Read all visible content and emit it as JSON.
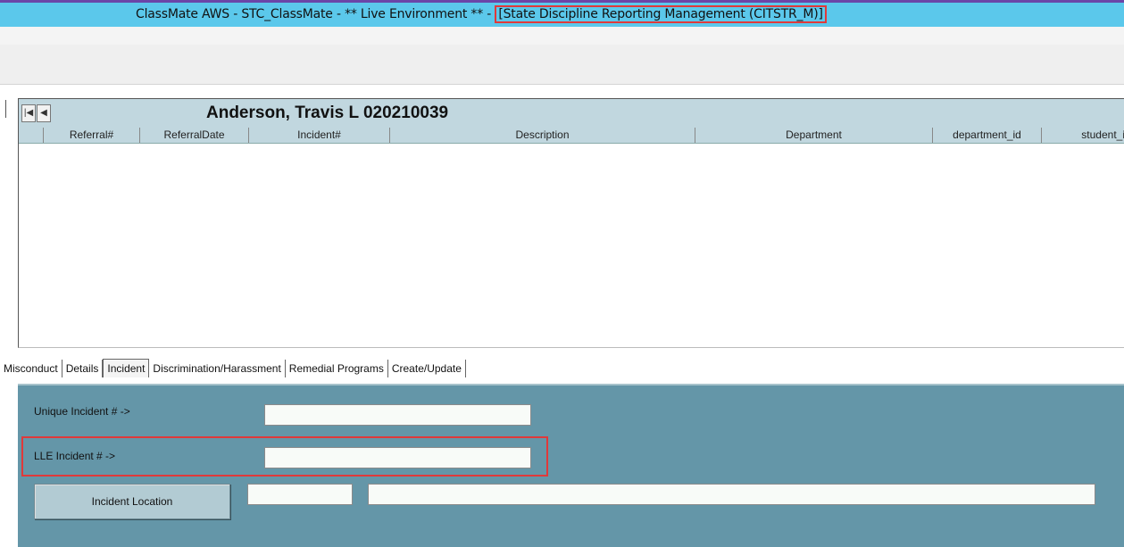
{
  "window": {
    "title_prefix": "ClassMate AWS - STC_ClassMate - ** Live Environment ** - ",
    "title_highlight": "[State Discipline Reporting Management (CITSTR_M)]"
  },
  "grid": {
    "nav_first_icon": "first-record-icon",
    "nav_prev_icon": "previous-record-icon",
    "student_name": "Anderson, Travis L 020210039",
    "columns": [
      "Referral#",
      "ReferralDate",
      "Incident#",
      "Description",
      "Department",
      "department_id",
      "student_i"
    ]
  },
  "tabs": [
    "Misconduct",
    "Details",
    "Incident",
    "Discrimination/Harassment",
    "Remedial Programs",
    "Create/Update"
  ],
  "active_tab": "Incident",
  "incident_panel": {
    "unique_label": "Unique Incident # ->",
    "unique_value": "",
    "lle_label": "LLE Incident # ->",
    "lle_value": "",
    "location_button": "Incident Location",
    "location_code": "",
    "location_desc": ""
  },
  "colors": {
    "titlebar": "#5bc8eb",
    "panel": "#6496a8",
    "highlight": "#e0393a",
    "grid_header": "#c1d7df"
  }
}
